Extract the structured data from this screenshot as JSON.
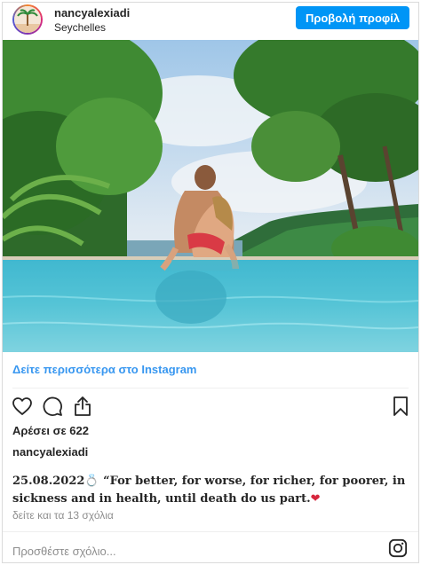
{
  "header": {
    "username": "nancyalexiadi",
    "location": "Seychelles",
    "profile_button": "Προβολή προφίλ"
  },
  "more_link": "Δείτε περισσότερα στο Instagram",
  "likes": "Αρέσει σε 622",
  "caption": {
    "username": "nancyalexiadi",
    "date": "25.08.2022",
    "text": "“For better, for worse, for richer, for poorer, in sickness and in health, until death do us part.",
    "emoji_ring": "💍",
    "emoji_heart": "❤"
  },
  "comments_link": "δείτε και τα 13 σχόλια",
  "comment_placeholder": "Προσθέστε σχόλιο...",
  "colors": {
    "accent": "#0095f6",
    "link": "#3897f0",
    "heart": "#ed4956"
  },
  "icons": [
    "heart-icon",
    "comment-icon",
    "share-icon",
    "bookmark-icon",
    "instagram-logo-icon"
  ]
}
